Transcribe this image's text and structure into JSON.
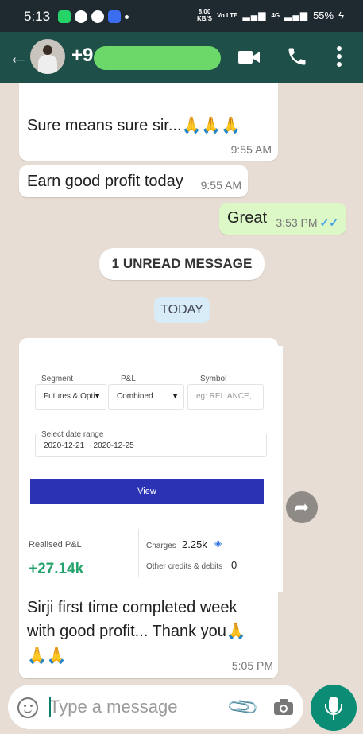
{
  "status_bar": {
    "time": "5:13",
    "speed_value": "8.00",
    "speed_unit": "KB/S",
    "network": "Vo LTE",
    "signal": "4G",
    "battery": "55%"
  },
  "header": {
    "contact_name": "+9",
    "back_icon": "arrow-left-icon",
    "video_icon": "video-call-icon",
    "call_icon": "phone-icon",
    "menu_icon": "more-vert-icon"
  },
  "messages": [
    {
      "direction": "in",
      "text": "Sure means sure sir...🙏🙏🙏",
      "time": "9:55 AM"
    },
    {
      "direction": "in",
      "text": "Earn good profit today",
      "time": "9:55 AM"
    },
    {
      "direction": "out",
      "text": "Great",
      "time": "3:53 PM",
      "status": "read"
    }
  ],
  "unread_banner": "1 UNREAD MESSAGE",
  "date_chip": "TODAY",
  "image_message": {
    "segment_label": "Segment",
    "segment_value": "Futures & Opti",
    "pl_label": "P&L",
    "pl_value": "Combined",
    "symbol_label": "Symbol",
    "symbol_placeholder": "eg: RELIANCE,",
    "date_range_label": "Select date range",
    "date_range_value": "2020-12-21 ~ 2020-12-25",
    "view_button": "View",
    "realised_label": "Realised P&L",
    "realised_value": "+27.14k",
    "charges_label": "Charges",
    "charges_value": "2.25k",
    "credits_label": "Other credits & debits",
    "credits_value": "0",
    "caption_line1": "Sirji first time completed week",
    "caption_line2": "with good profit... Thank you🙏",
    "caption_line3": "🙏🙏",
    "time": "5:05 PM"
  },
  "composer": {
    "placeholder": "Type a message",
    "emoji_icon": "emoji-icon",
    "attach_icon": "paperclip-icon",
    "camera_icon": "camera-icon",
    "mic_icon": "microphone-icon"
  },
  "colors": {
    "header": "#1e4f48",
    "status_bar": "#1f2a30",
    "chat_background": "#e7ddd4",
    "outgoing_bubble": "#dcf8c6",
    "read_ticks": "#45a4e3",
    "mic_button": "#0a8d74",
    "view_button": "#2b33b4",
    "profit": "#24a36c"
  }
}
